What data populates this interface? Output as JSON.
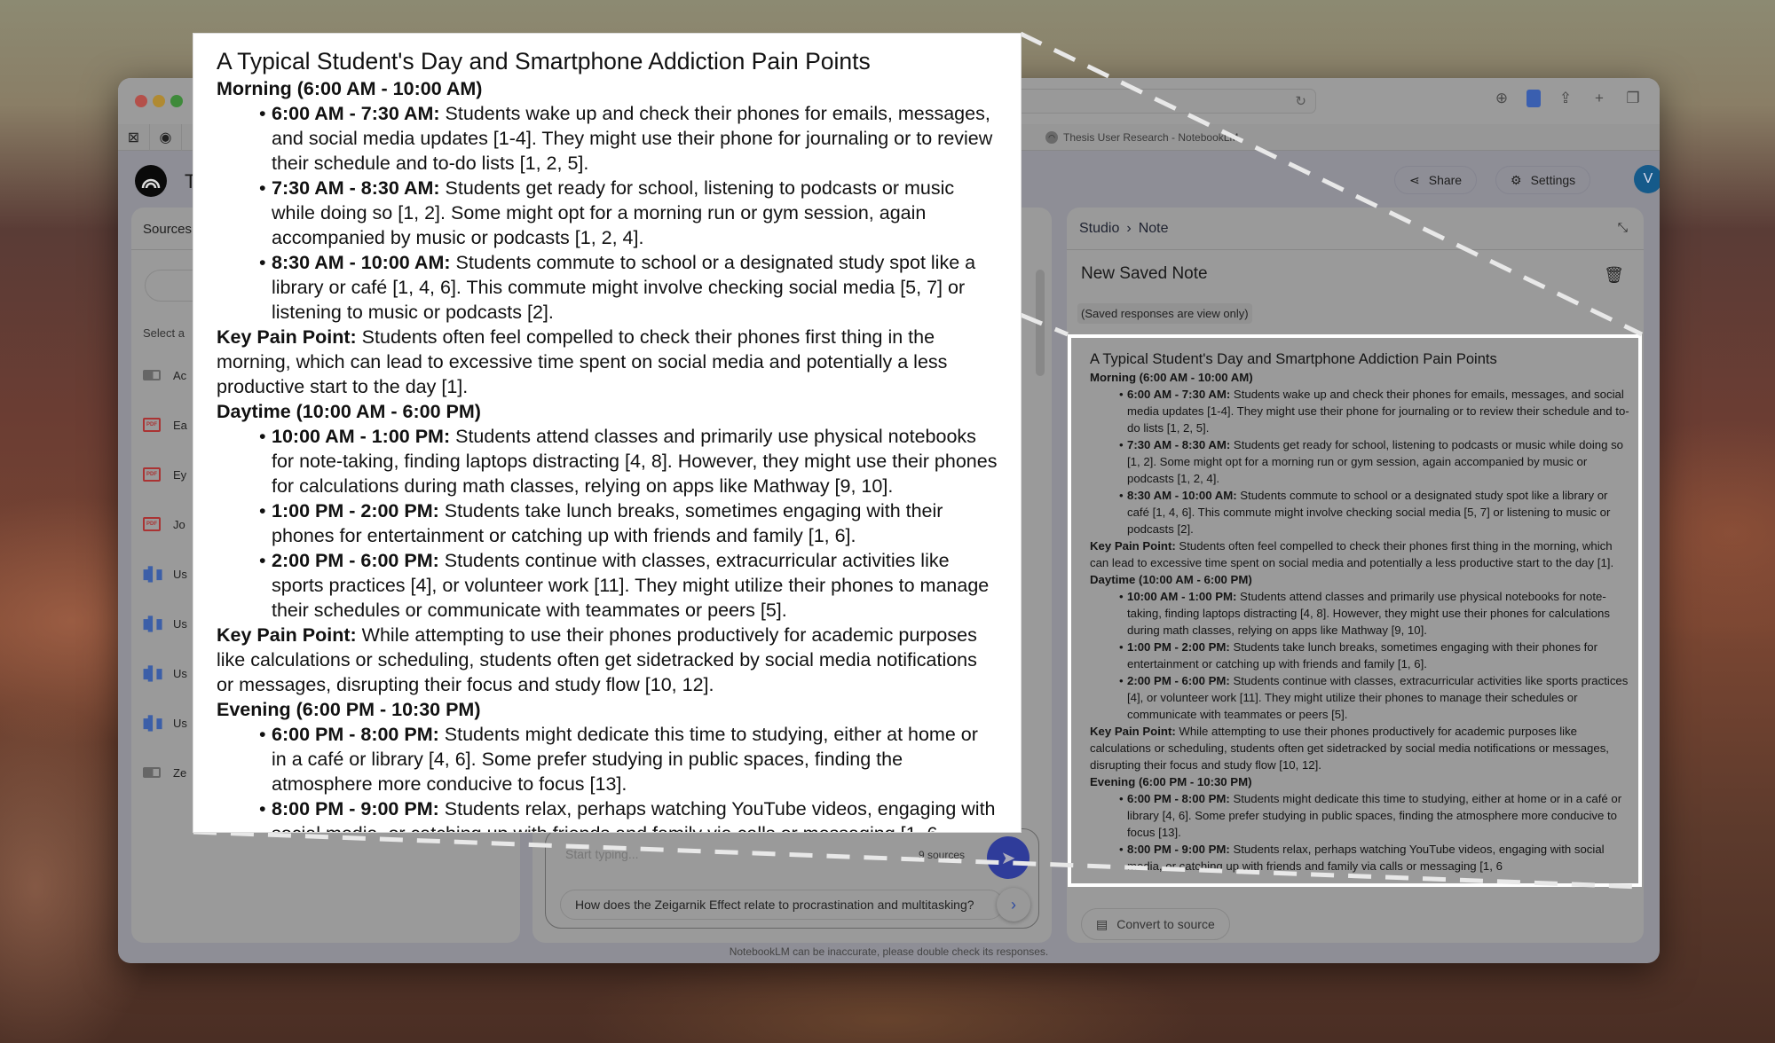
{
  "browser": {
    "active_tab_title": "Thesis User Research - NotebookLM",
    "pinned_tabs": [
      "x-box-icon",
      "github-icon",
      "app-icon"
    ],
    "toolbar_icons": [
      "download-icon",
      "document-icon",
      "share-icon",
      "plus-icon",
      "tabs-icon"
    ]
  },
  "header": {
    "title_initial": "T",
    "share_label": "Share",
    "settings_label": "Settings",
    "avatar_letter": "V"
  },
  "sources": {
    "header": "Sources",
    "select_all_label": "Select a",
    "items": [
      {
        "type": "web",
        "label": "Ac"
      },
      {
        "type": "pdf",
        "label": "Ea"
      },
      {
        "type": "pdf",
        "label": "Ey"
      },
      {
        "type": "pdf",
        "label": "Jo"
      },
      {
        "type": "audio",
        "label": "Us"
      },
      {
        "type": "audio",
        "label": "Us"
      },
      {
        "type": "audio",
        "label": "Us"
      },
      {
        "type": "audio",
        "label": "Us"
      },
      {
        "type": "web",
        "label": "Ze"
      }
    ]
  },
  "chat": {
    "input_placeholder": "Start typing...",
    "sources_count": "9 sources",
    "suggestion": "How does the Zeigarnik Effect relate to procrastination and multitasking?"
  },
  "studio": {
    "breadcrumb": [
      "Studio",
      "Note"
    ],
    "note_title": "New Saved Note",
    "view_only_label": "(Saved responses are view only)",
    "convert_label": "Convert to source"
  },
  "note": {
    "title": "A Typical Student's Day and Smartphone Addiction Pain Points",
    "morning": {
      "heading": "Morning (6:00 AM - 10:00 AM)",
      "items": [
        {
          "time": "6:00 AM - 7:30 AM:",
          "text": " Students wake up and check their phones for emails, messages, and social media updates [1-4]. They might use their phone for journaling or to review their schedule and to-do lists [1, 2, 5]."
        },
        {
          "time": "7:30 AM - 8:30 AM:",
          "text": " Students get ready for school, listening to podcasts or music while doing so [1, 2]. Some might opt for a morning run or gym session, again accompanied by music or podcasts [1, 2, 4]."
        },
        {
          "time": "8:30 AM - 10:00 AM:",
          "text": " Students commute to school or a designated study spot like a library or café [1, 4, 6]. This commute might involve checking social media [5, 7] or listening to music or podcasts [2]."
        }
      ],
      "pain_label": "Key Pain Point:",
      "pain_text": " Students often feel compelled to check their phones first thing in the morning, which can lead to excessive time spent on social media and potentially a less productive start to the day [1]."
    },
    "daytime": {
      "heading": "Daytime (10:00 AM - 6:00 PM)",
      "items": [
        {
          "time": "10:00 AM - 1:00 PM:",
          "text": " Students attend classes and primarily use physical notebooks for note-taking, finding laptops distracting [4, 8]. However, they might use their phones for calculations during math classes, relying on apps like Mathway [9, 10]."
        },
        {
          "time": "1:00 PM - 2:00 PM:",
          "text": " Students take lunch breaks, sometimes engaging with their phones for entertainment or catching up with friends and family [1, 6]."
        },
        {
          "time": "2:00 PM - 6:00 PM:",
          "text": " Students continue with classes, extracurricular activities like sports practices [4], or volunteer work [11]. They might utilize their phones to manage their schedules or communicate with teammates or peers [5]."
        }
      ],
      "pain_label": "Key Pain Point:",
      "pain_text": " While attempting to use their phones productively for academic purposes like calculations or scheduling, students often get sidetracked by social media notifications or messages, disrupting their focus and study flow [10, 12]."
    },
    "evening": {
      "heading": "Evening (6:00 PM - 10:30 PM)",
      "items": [
        {
          "time": "6:00 PM - 8:00 PM:",
          "text": " Students might dedicate this time to studying, either at home or in a café or library [4, 6]. Some prefer studying in public spaces, finding the atmosphere more conducive to focus [13]."
        },
        {
          "time": "8:00 PM - 9:00 PM:",
          "text": " Students relax, perhaps watching YouTube videos, engaging with social media, or catching up with friends and family via calls or messaging [1, 6"
        }
      ]
    }
  },
  "footer": {
    "disclaimer": "NotebookLM can be inaccurate, please double check its responses."
  }
}
